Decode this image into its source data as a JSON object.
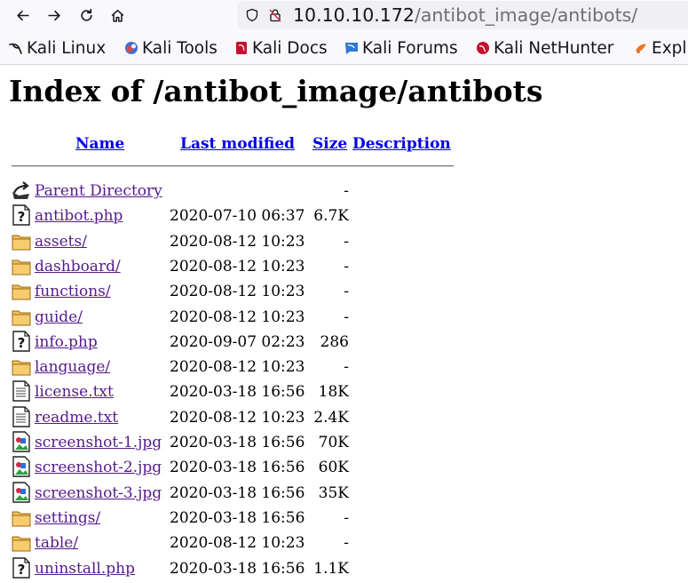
{
  "browser": {
    "url_host": "10.10.10.172",
    "url_path": "/antibot_image/antibots/",
    "bookmarks": [
      {
        "label": "Kali Linux",
        "icon": "kali-dragon-icon"
      },
      {
        "label": "Kali Tools",
        "icon": "kali-tools-icon"
      },
      {
        "label": "Kali Docs",
        "icon": "kali-docs-icon"
      },
      {
        "label": "Kali Forums",
        "icon": "kali-forums-icon"
      },
      {
        "label": "Kali NetHunter",
        "icon": "kali-nethunter-icon"
      },
      {
        "label": "Expl",
        "icon": "exploit-db-icon"
      }
    ]
  },
  "page": {
    "title": "Index of /antibot_image/antibots",
    "columns": {
      "name": "Name",
      "last_modified": "Last modified",
      "size": "Size",
      "description": "Description"
    },
    "rows": [
      {
        "name": "Parent Directory",
        "date": "",
        "size": "-",
        "icon": "parent-directory-icon"
      },
      {
        "name": "antibot.php",
        "date": "2020-07-10 06:37",
        "size": "6.7K",
        "icon": "unknown-file-icon"
      },
      {
        "name": "assets/",
        "date": "2020-08-12 10:23",
        "size": "-",
        "icon": "folder-icon"
      },
      {
        "name": "dashboard/",
        "date": "2020-08-12 10:23",
        "size": "-",
        "icon": "folder-icon"
      },
      {
        "name": "functions/",
        "date": "2020-08-12 10:23",
        "size": "-",
        "icon": "folder-icon"
      },
      {
        "name": "guide/",
        "date": "2020-08-12 10:23",
        "size": "-",
        "icon": "folder-icon"
      },
      {
        "name": "info.php",
        "date": "2020-09-07 02:23",
        "size": "286",
        "icon": "unknown-file-icon"
      },
      {
        "name": "language/",
        "date": "2020-08-12 10:23",
        "size": "-",
        "icon": "folder-icon"
      },
      {
        "name": "license.txt",
        "date": "2020-03-18 16:56",
        "size": "18K",
        "icon": "text-file-icon"
      },
      {
        "name": "readme.txt",
        "date": "2020-08-12 10:23",
        "size": "2.4K",
        "icon": "text-file-icon"
      },
      {
        "name": "screenshot-1.jpg",
        "date": "2020-03-18 16:56",
        "size": "70K",
        "icon": "image-file-icon"
      },
      {
        "name": "screenshot-2.jpg",
        "date": "2020-03-18 16:56",
        "size": "60K",
        "icon": "image-file-icon"
      },
      {
        "name": "screenshot-3.jpg",
        "date": "2020-03-18 16:56",
        "size": "35K",
        "icon": "image-file-icon"
      },
      {
        "name": "settings/",
        "date": "2020-03-18 16:56",
        "size": "-",
        "icon": "folder-icon"
      },
      {
        "name": "table/",
        "date": "2020-08-12 10:23",
        "size": "-",
        "icon": "folder-icon"
      },
      {
        "name": "uninstall.php",
        "date": "2020-03-18 16:56",
        "size": "1.1K",
        "icon": "unknown-file-icon"
      }
    ]
  },
  "colors": {
    "link_unvisited": "#0000ee",
    "link_visited": "#551a8b",
    "folder": "#f2bf5c"
  }
}
